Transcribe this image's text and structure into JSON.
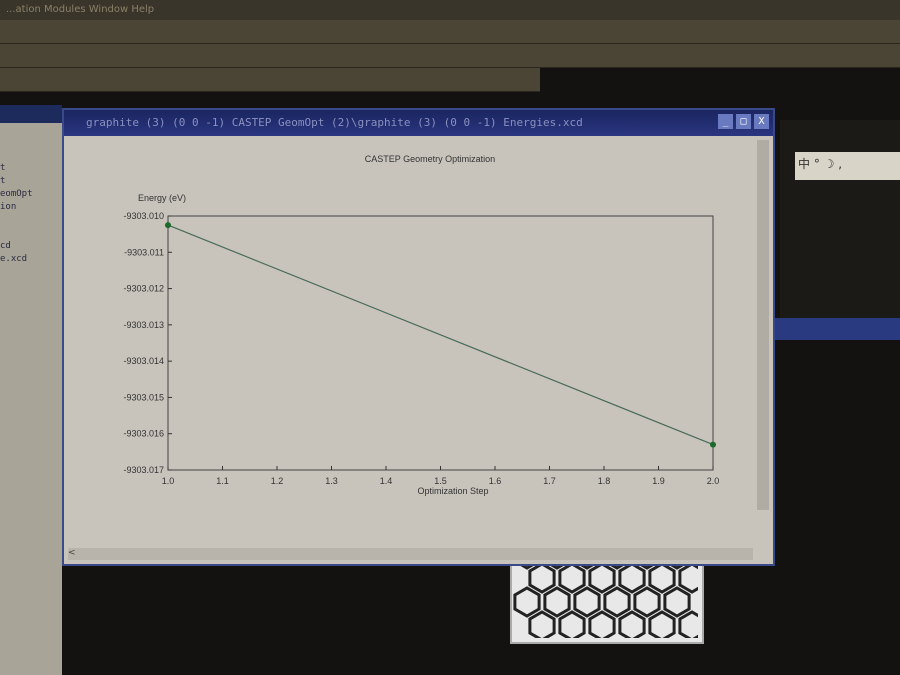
{
  "menubar": {
    "text": "...ation  Modules  Window  Help"
  },
  "left_panel": {
    "items": [
      "t",
      "t",
      "eomOpt",
      "ion",
      "",
      "",
      "cd",
      "e.xcd"
    ]
  },
  "ime_bar": {
    "text": "中 ° ☽ ,"
  },
  "window": {
    "title": "graphite (3) (0 0 -1) CASTEP GeomOpt (2)\\graphite (3) (0 0 -1) Energies.xcd",
    "min": "_",
    "max": "□",
    "close": "X",
    "scroll_left": "<"
  },
  "chart_data": {
    "type": "line",
    "title": "CASTEP Geometry Optimization",
    "xlabel": "Optimization Step",
    "ylabel": "Energy (eV)",
    "x": [
      1.0,
      2.0
    ],
    "series": [
      {
        "name": "Energy",
        "values": [
          -9303.01025,
          -9303.0163
        ]
      }
    ],
    "xlim": [
      1.0,
      2.0
    ],
    "ylim": [
      -9303.017,
      -9303.01
    ],
    "xticks": [
      "1.0",
      "1.1",
      "1.2",
      "1.3",
      "1.4",
      "1.5",
      "1.6",
      "1.7",
      "1.8",
      "1.9",
      "2.0"
    ],
    "yticks": [
      "-9303.010",
      "-9303.011",
      "-9303.012",
      "-9303.013",
      "-9303.014",
      "-9303.015",
      "-9303.016",
      "-9303.017"
    ],
    "grid": false,
    "line_color": "#4a6a5a",
    "marker_color": "#1a6a2a"
  }
}
